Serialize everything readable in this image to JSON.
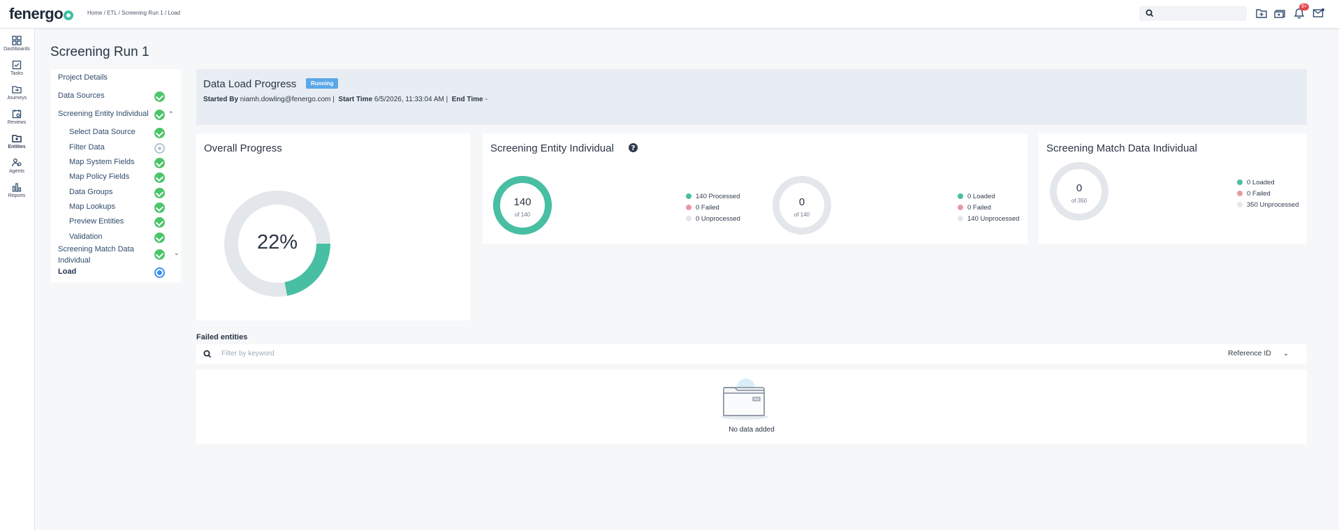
{
  "header": {
    "logo": "fenergo",
    "breadcrumb": "Home / ETL / Screening Run 1 / Load",
    "search_placeholder": "",
    "notification_count": "9+"
  },
  "rail": [
    {
      "label": "Dashboards",
      "icon": "dashboards-icon"
    },
    {
      "label": "Tasks",
      "icon": "tasks-icon"
    },
    {
      "label": "Journeys",
      "icon": "journeys-icon"
    },
    {
      "label": "Reviews",
      "icon": "reviews-icon"
    },
    {
      "label": "Entities",
      "icon": "entities-icon"
    },
    {
      "label": "Agents",
      "icon": "agents-icon"
    },
    {
      "label": "Reports",
      "icon": "reports-icon"
    }
  ],
  "page_title": "Screening Run 1",
  "steps": {
    "project_details": "Project Details",
    "data_sources": "Data Sources",
    "screening_entity_individual": "Screening Entity Individual",
    "sub": [
      "Select Data Source",
      "Filter Data",
      "Map System Fields",
      "Map Policy Fields",
      "Data Groups",
      "Map Lookups",
      "Preview Entities",
      "Validation"
    ],
    "screening_match_line1": "Screening Match Data",
    "screening_match_line2": "Individual",
    "load": "Load"
  },
  "load_progress": {
    "title": "Data Load Progress",
    "status": "Running",
    "started_by_label": "Started By",
    "started_by": "niamh.dowling@fenergo.com",
    "start_time_label": "Start Time",
    "start_time": "6/5/2026, 11:33:04 AM",
    "end_time_label": "End Time",
    "end_time": "-"
  },
  "overall": {
    "title": "Overall Progress",
    "percent_label": "22%",
    "percent": 0.22
  },
  "entity_individual": {
    "title": "Screening Entity Individual",
    "processed": {
      "value": "140",
      "of": "of 140",
      "fraction": 1.0
    },
    "processed_legend": [
      "140 Processed",
      "0 Failed",
      "0 Unprocessed"
    ],
    "loaded": {
      "value": "0",
      "of": "of 140",
      "fraction": 0
    },
    "loaded_legend": [
      "0 Loaded",
      "0 Failed",
      "140 Unprocessed"
    ]
  },
  "match_individual": {
    "title": "Screening Match Data Individual",
    "loaded": {
      "value": "0",
      "of": "of 350",
      "fraction": 0
    },
    "legend": [
      "0 Loaded",
      "0 Failed",
      "350 Unprocessed"
    ]
  },
  "failed_entities": {
    "title": "Failed entities",
    "filter_placeholder": "Filter by keyword",
    "column_select": "Reference ID",
    "empty_text": "No data added"
  },
  "colors": {
    "teal": "#48bfa3",
    "failed": "#e89aa4",
    "unprocessed": "#e3e7ec",
    "running": "#5aa8e8"
  }
}
